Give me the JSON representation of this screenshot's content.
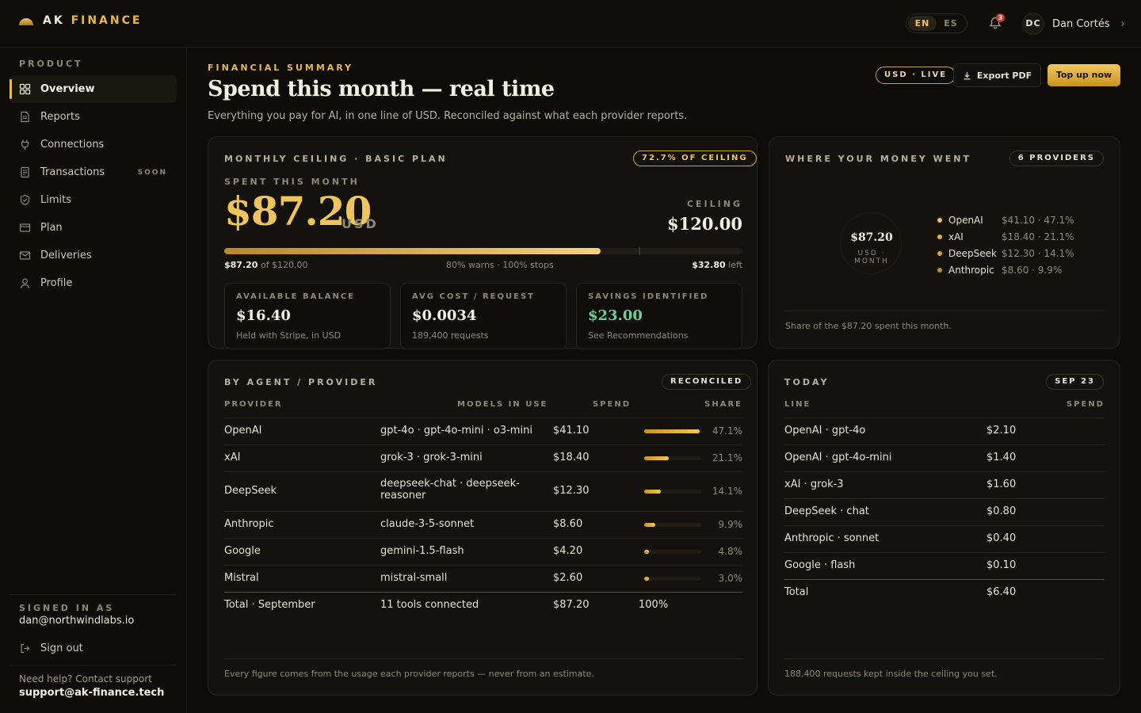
{
  "brand": {
    "first": "AK",
    "second": "FINANCE"
  },
  "lang": {
    "en": "EN",
    "es": "ES"
  },
  "notifications": {
    "count": "3"
  },
  "user": {
    "initials": "DC",
    "name": "Dan Cortés"
  },
  "sidebar": {
    "heading": "PRODUCT",
    "items": [
      {
        "label": "Overview",
        "icon": "grid-icon"
      },
      {
        "label": "Reports",
        "icon": "document-icon"
      },
      {
        "label": "Connections",
        "icon": "plug-icon"
      },
      {
        "label": "Transactions",
        "icon": "receipt-icon",
        "badge": "SOON"
      },
      {
        "label": "Limits",
        "icon": "shield-icon"
      },
      {
        "label": "Plan",
        "icon": "card-icon"
      },
      {
        "label": "Deliveries",
        "icon": "mail-icon"
      },
      {
        "label": "Profile",
        "icon": "user-icon"
      }
    ],
    "signed_label": "SIGNED IN AS",
    "signed_email": "dan@northwindlabs.io",
    "signout": "Sign out",
    "help": "Need help? Contact support",
    "help_email": "support@ak-finance.tech"
  },
  "header": {
    "eyebrow": "FINANCIAL SUMMARY",
    "title": "Spend this month — real time",
    "subtitle": "Everything you pay for AI, in one line of USD. Reconciled against what each provider reports.",
    "live_pill": "USD · LIVE",
    "export": "Export PDF",
    "topup": "Top up now"
  },
  "ceiling": {
    "title": "MONTHLY CEILING · BASIC PLAN",
    "pill": "72.7% OF CEILING",
    "spent_label": "SPENT THIS MONTH",
    "spent": "$87.20",
    "unit": "USD",
    "ceiling_label": "CEILING",
    "ceiling": "$120.00",
    "progress": 0.727,
    "bar_left_b": "$87.20",
    "bar_left": "of $120.00",
    "bar_mid": "80% warns · 100% stops",
    "bar_right_b": "$32.80",
    "bar_right": "left",
    "kpis": [
      {
        "label": "AVAILABLE BALANCE",
        "value": "$16.40",
        "sub": "Held with Stripe, in USD"
      },
      {
        "label": "AVG COST / REQUEST",
        "value": "$0.0034",
        "sub": "189,400 requests"
      },
      {
        "label": "SAVINGS IDENTIFIED",
        "value": "$23.00",
        "sub": "See Recommendations"
      }
    ]
  },
  "money": {
    "title": "WHERE YOUR MONEY WENT",
    "pill": "6 PROVIDERS",
    "donut_value": "$87.20",
    "donut_label": "USD · MONTH",
    "legend": [
      {
        "name": "OpenAI",
        "value": "$41.10 · 47.1%",
        "color": "#f0c45a"
      },
      {
        "name": "xAI",
        "value": "$18.40 · 21.1%",
        "color": "#e2b347"
      },
      {
        "name": "DeepSeek",
        "value": "$12.30 · 14.1%",
        "color": "#d4a23c"
      },
      {
        "name": "Anthropic",
        "value": "$8.60 · 9.9%",
        "color": "#c08c2e"
      }
    ],
    "footer": "Share of the $87.20 spent this month."
  },
  "by_agent": {
    "title": "BY AGENT / PROVIDER",
    "pill": "RECONCILED",
    "headers": {
      "provider": "PROVIDER",
      "models": "MODELS IN USE",
      "spend": "SPEND",
      "share": "SHARE"
    },
    "rows": [
      {
        "provider": "OpenAI",
        "models": "gpt-4o · gpt-4o-mini · o3-mini",
        "spend": "$41.10",
        "share": "47.1%",
        "fill": 0.97
      },
      {
        "provider": "xAI",
        "models": "grok-3 · grok-3-mini",
        "spend": "$18.40",
        "share": "21.1%",
        "fill": 0.43
      },
      {
        "provider": "DeepSeek",
        "models": "deepseek-chat · deepseek-reasoner",
        "spend": "$12.30",
        "share": "14.1%",
        "fill": 0.29
      },
      {
        "provider": "Anthropic",
        "models": "claude-3-5-sonnet",
        "spend": "$8.60",
        "share": "9.9%",
        "fill": 0.2
      },
      {
        "provider": "Google",
        "models": "gemini-1.5-flash",
        "spend": "$4.20",
        "share": "4.8%",
        "fill": 0.08
      },
      {
        "provider": "Mistral",
        "models": "mistral-small",
        "spend": "$2.60",
        "share": "3.0%",
        "fill": 0.06
      }
    ],
    "total": {
      "provider": "Total · September",
      "models": "11 tools connected",
      "spend": "$87.20",
      "share": "100%"
    },
    "footer": "Every figure comes from the usage each provider reports — never from an estimate."
  },
  "today": {
    "title": "TODAY",
    "pill": "SEP 23",
    "headers": {
      "line": "LINE",
      "spend": "SPEND"
    },
    "rows": [
      {
        "line": "OpenAI · gpt-4o",
        "spend": "$2.10"
      },
      {
        "line": "OpenAI · gpt-4o-mini",
        "spend": "$1.40"
      },
      {
        "line": "xAI · grok-3",
        "spend": "$1.60"
      },
      {
        "line": "DeepSeek · chat",
        "spend": "$0.80"
      },
      {
        "line": "Anthropic · sonnet",
        "spend": "$0.40"
      },
      {
        "line": "Google · flash",
        "spend": "$0.10"
      }
    ],
    "total": {
      "line": "Total",
      "spend": "$6.40"
    },
    "footer": "188,400 requests kept inside the ceiling you set."
  }
}
